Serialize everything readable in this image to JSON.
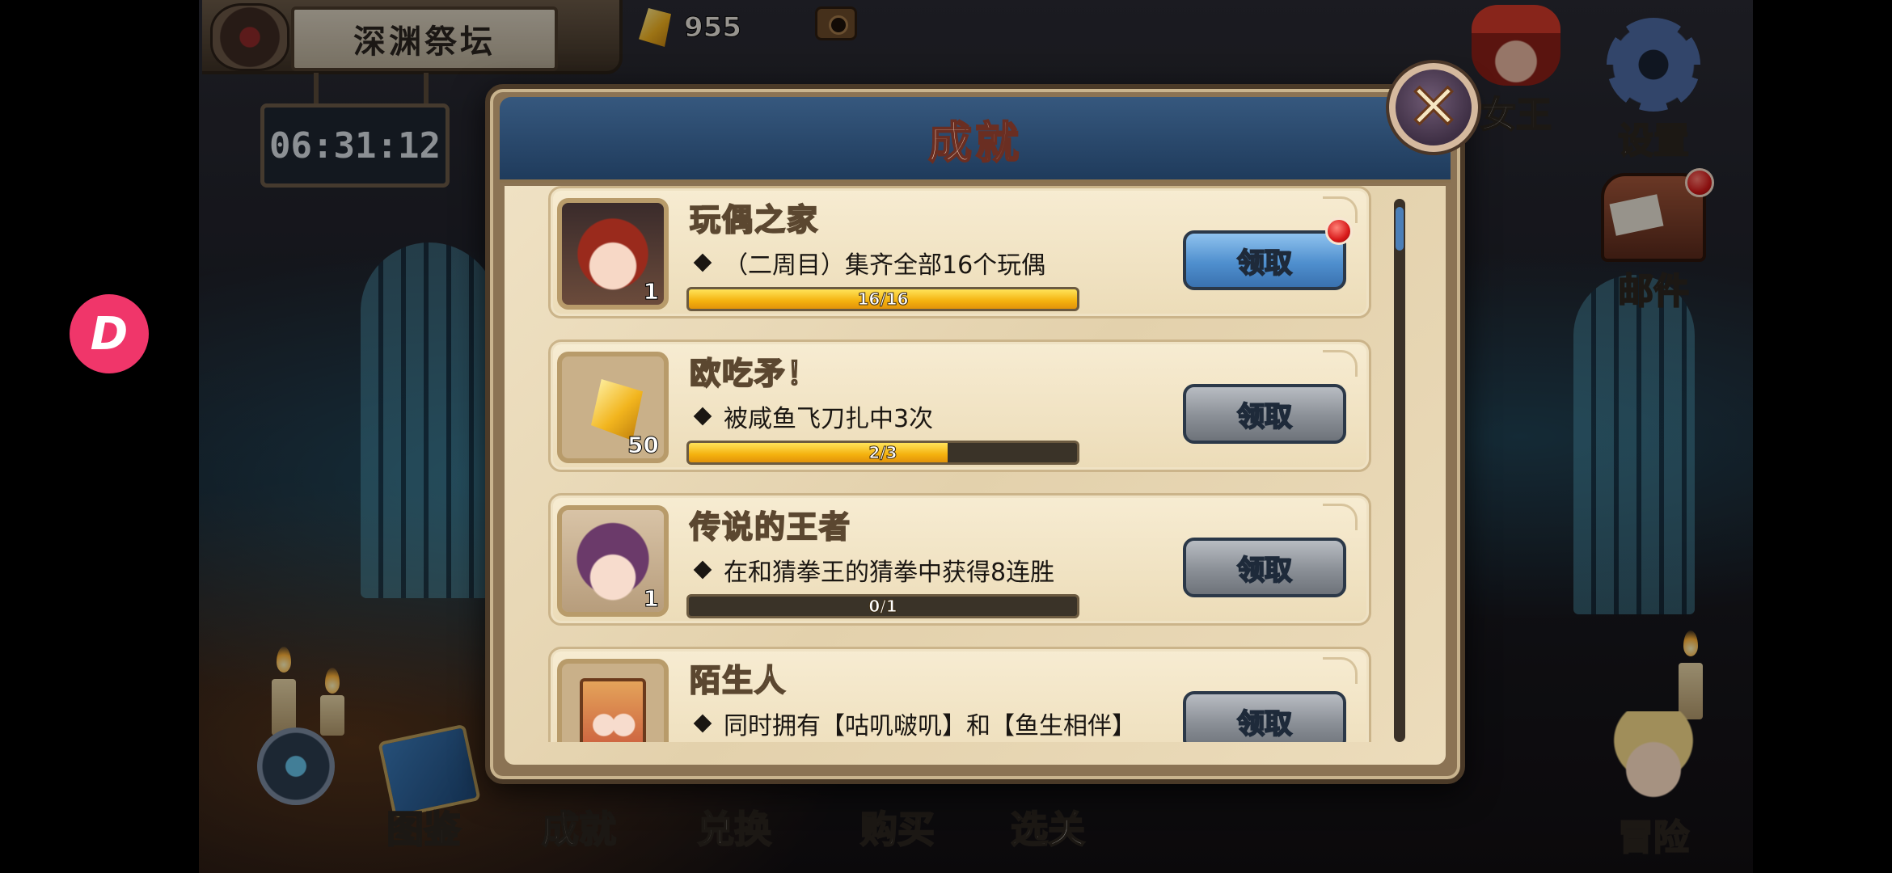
{
  "location": {
    "name": "深渊祭坛",
    "timer": "06:31:12"
  },
  "currency": {
    "gem_icon": "crystal-icon",
    "amount": "955"
  },
  "side_menu": {
    "queen_label": "女王",
    "settings_label": "设置",
    "mail_label": "邮件",
    "adventure_label": "冒险"
  },
  "bottom_nav": [
    {
      "label": "图鉴",
      "icon": "codex-icon"
    },
    {
      "label": "成就",
      "icon": "achievement-icon"
    },
    {
      "label": "兑换",
      "icon": "exchange-icon"
    },
    {
      "label": "购买",
      "icon": "shop-icon"
    },
    {
      "label": "选关",
      "icon": "stage-select-icon"
    }
  ],
  "floating_icon": {
    "glyph": "D"
  },
  "dialog": {
    "title": "成就",
    "close_glyph": "✕",
    "claim_label": "领取",
    "achievements": [
      {
        "title": "玩偶之家",
        "desc": "（二周目）集齐全部16个玩偶",
        "progress_text": "16/16",
        "progress": 1.0,
        "reward_count": "1",
        "icon": "doll-portrait-icon",
        "claimable": true,
        "has_alert": true
      },
      {
        "title": "欧吃矛！",
        "desc": "被咸鱼飞刀扎中3次",
        "progress_text": "2/3",
        "progress": 0.6667,
        "reward_count": "50",
        "icon": "crystal-reward-icon",
        "claimable": false,
        "has_alert": false
      },
      {
        "title": "传说的王者",
        "desc": "在和猜拳王的猜拳中获得8连胜",
        "progress_text": "0/1",
        "progress": 0.0,
        "reward_count": "1",
        "icon": "king-portrait-icon",
        "claimable": false,
        "has_alert": false
      },
      {
        "title": "陌生人",
        "desc": "同时拥有【咕叽啵叽】和【鱼生相伴】",
        "progress_text": "",
        "progress": 0.0,
        "reward_count": "",
        "icon": "stranger-card-icon",
        "claimable": false,
        "has_alert": false
      }
    ]
  },
  "colors": {
    "claim_active": "#4f8fce",
    "claim_inactive": "#8a8f96",
    "progress_fill": "#f4b10e",
    "header_blue": "#2a4a6e"
  }
}
